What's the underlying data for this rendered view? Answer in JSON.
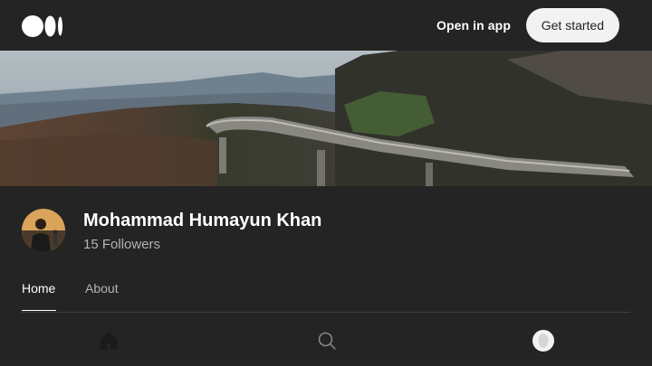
{
  "header": {
    "logo_icon": "medium-logo-icon",
    "open_in_app": "Open in app",
    "get_started": "Get started"
  },
  "banner": {
    "icon": "mountain-road-banner-image"
  },
  "profile": {
    "name": "Mohammad Humayun Khan",
    "followers": "15 Followers",
    "avatar_icon": "user-avatar"
  },
  "tabs": [
    {
      "label": "Home",
      "active": true
    },
    {
      "label": "About",
      "active": false
    }
  ],
  "bottom_nav": {
    "items": [
      "home-icon",
      "search-icon",
      "profile-avatar-icon"
    ]
  },
  "colors": {
    "background": "#242424",
    "button_bg": "#f2f2f2",
    "muted_text": "#b3b3b3",
    "divider": "#3f3f3f"
  }
}
